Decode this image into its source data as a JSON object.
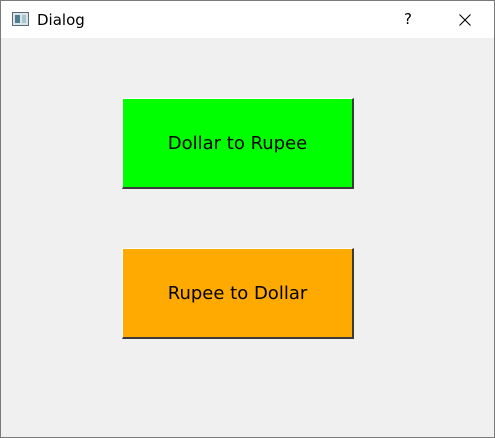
{
  "window": {
    "title": "Dialog",
    "help_label": "?",
    "icon": "app-window-icon",
    "close_icon": "close-icon"
  },
  "buttons": {
    "dollar_to_rupee": {
      "label": "Dollar to Rupee",
      "color": "#00ff00"
    },
    "rupee_to_dollar": {
      "label": "Rupee to Dollar",
      "color": "#ffaa00"
    }
  }
}
